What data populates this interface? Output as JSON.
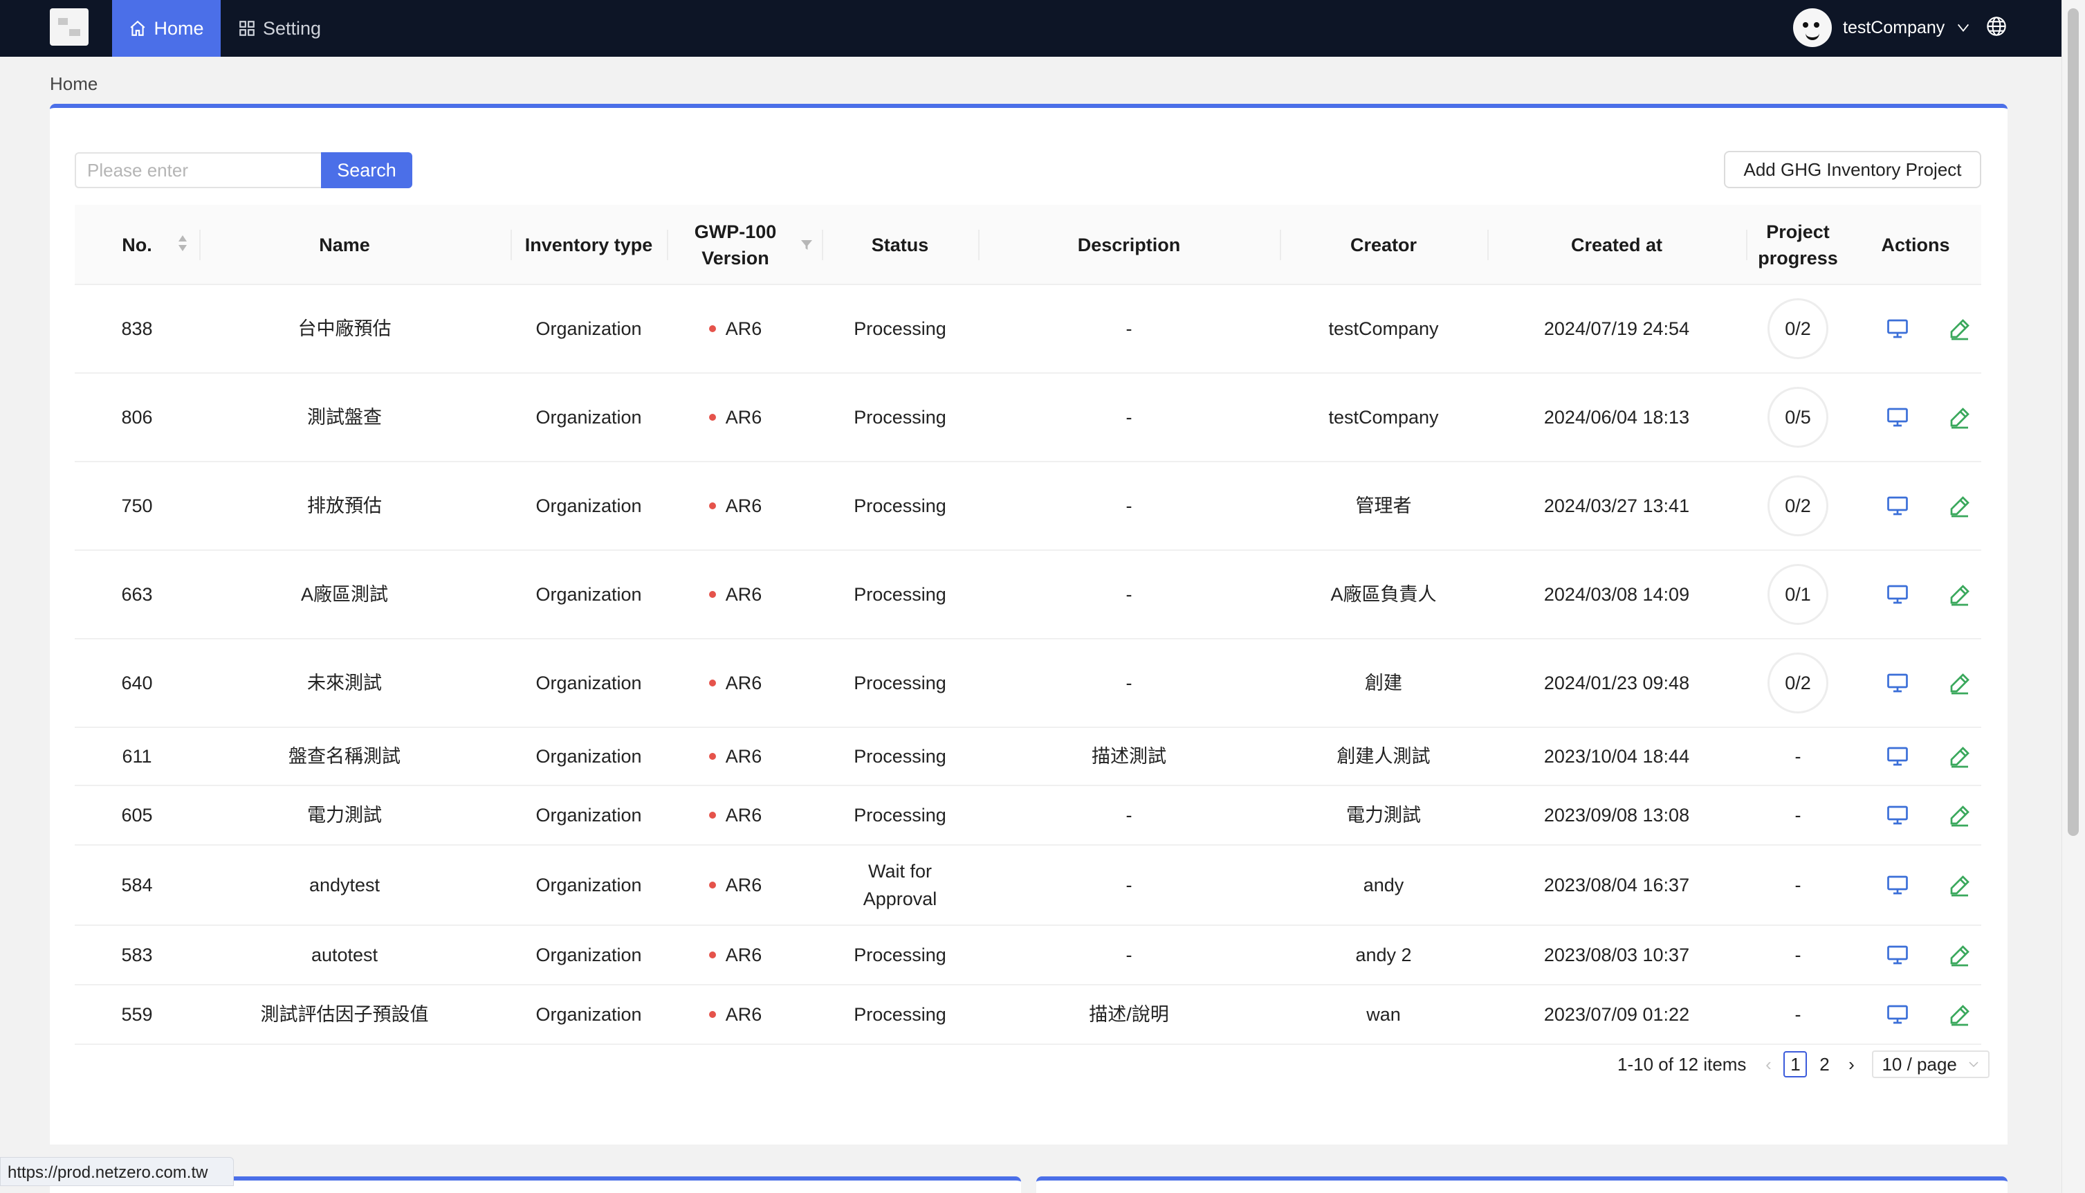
{
  "nav": {
    "home_label": "Home",
    "setting_label": "Setting",
    "username": "testCompany"
  },
  "breadcrumb": "Home",
  "toolbar": {
    "search_placeholder": "Please enter",
    "search_label": "Search",
    "add_label": "Add GHG Inventory Project"
  },
  "table": {
    "headers": {
      "no": "No.",
      "name": "Name",
      "inventory_type": "Inventory type",
      "gwp_version": "GWP-100 Version",
      "status": "Status",
      "description": "Description",
      "creator": "Creator",
      "created_at": "Created at",
      "progress": "Project progress",
      "actions": "Actions"
    },
    "rows": [
      {
        "no": "838",
        "name": "台中廠預估",
        "type": "Organization",
        "gwp": "AR6",
        "status": "Processing",
        "description": "-",
        "creator": "testCompany",
        "created_at": "2024/07/19 24:54",
        "progress": "0/2"
      },
      {
        "no": "806",
        "name": "測試盤查",
        "type": "Organization",
        "gwp": "AR6",
        "status": "Processing",
        "description": "-",
        "creator": "testCompany",
        "created_at": "2024/06/04 18:13",
        "progress": "0/5"
      },
      {
        "no": "750",
        "name": "排放預估",
        "type": "Organization",
        "gwp": "AR6",
        "status": "Processing",
        "description": "-",
        "creator": "管理者",
        "created_at": "2024/03/27 13:41",
        "progress": "0/2"
      },
      {
        "no": "663",
        "name": "A廠區測試",
        "type": "Organization",
        "gwp": "AR6",
        "status": "Processing",
        "description": "-",
        "creator": "A廠區負責人",
        "created_at": "2024/03/08 14:09",
        "progress": "0/1"
      },
      {
        "no": "640",
        "name": "未來測試",
        "type": "Organization",
        "gwp": "AR6",
        "status": "Processing",
        "description": "-",
        "creator": "創建",
        "created_at": "2024/01/23 09:48",
        "progress": "0/2"
      },
      {
        "no": "611",
        "name": "盤查名稱測試",
        "type": "Organization",
        "gwp": "AR6",
        "status": "Processing",
        "description": "描述測試",
        "creator": "創建人測試",
        "created_at": "2023/10/04 18:44",
        "progress": "-"
      },
      {
        "no": "605",
        "name": "電力測試",
        "type": "Organization",
        "gwp": "AR6",
        "status": "Processing",
        "description": "-",
        "creator": "電力測試",
        "created_at": "2023/09/08 13:08",
        "progress": "-"
      },
      {
        "no": "584",
        "name": "andytest",
        "type": "Organization",
        "gwp": "AR6",
        "status": "Wait for Approval",
        "description": "-",
        "creator": "andy",
        "created_at": "2023/08/04 16:37",
        "progress": "-"
      },
      {
        "no": "583",
        "name": "autotest",
        "type": "Organization",
        "gwp": "AR6",
        "status": "Processing",
        "description": "-",
        "creator": "andy 2",
        "created_at": "2023/08/03 10:37",
        "progress": "-"
      },
      {
        "no": "559",
        "name": "測試評估因子預設值",
        "type": "Organization",
        "gwp": "AR6",
        "status": "Processing",
        "description": "描述/說明",
        "creator": "wan",
        "created_at": "2023/07/09 01:22",
        "progress": "-"
      }
    ]
  },
  "pagination": {
    "total": "1-10 of 12 items",
    "pages": [
      "1",
      "2"
    ],
    "current": "1",
    "page_size": "10 / page"
  },
  "status_url": "https://prod.netzero.com.tw",
  "colors": {
    "nav_bg": "#0d1526",
    "accent": "#4b6fe8",
    "status_dot": "#e5534b",
    "view_icon": "#3b6fd8",
    "edit_icon": "#3aa85c"
  },
  "icons": {
    "home": "home-icon",
    "setting": "grid-icon",
    "language": "globe-icon",
    "view": "monitor-icon",
    "edit": "pencil-icon",
    "filter": "filter-icon"
  }
}
